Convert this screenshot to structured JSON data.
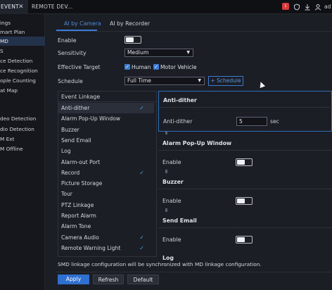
{
  "topbar": {
    "tabs": [
      "EVENT",
      "REMOTE DEV..."
    ],
    "close_glyph": "✕",
    "badge": "1",
    "user": "ad",
    "icons": [
      "notification-icon",
      "shield-icon",
      "download-icon",
      "user-icon"
    ]
  },
  "leftnav": {
    "items": [
      "ings",
      "mart Plan",
      "MD",
      "S",
      "ce Detection",
      "ce Recognition",
      "ople Counting",
      "at Map",
      "deo Detection",
      "dio Detection",
      "M Ext",
      "M Offline"
    ],
    "selected_index": 2
  },
  "subtabs": [
    "AI by Camera",
    "AI by Recorder"
  ],
  "form": {
    "enable_label": "Enable",
    "sensitivity_label": "Sensitivity",
    "sensitivity_value": "Medium",
    "effective_target_label": "Effective Target",
    "target_human": "Human",
    "target_vehicle": "Motor Vehicle",
    "schedule_label": "Schedule",
    "schedule_value": "Full Time",
    "schedule_button": "+ Schedule"
  },
  "linkage": {
    "header": "Event Linkage",
    "items": [
      {
        "label": "Anti-dither",
        "checked": true
      },
      {
        "label": "Alarm Pop-Up Window",
        "checked": false
      },
      {
        "label": "Buzzer",
        "checked": false
      },
      {
        "label": "Send Email",
        "checked": false
      },
      {
        "label": "Log",
        "checked": false
      },
      {
        "label": "Alarm-out Port",
        "checked": false
      },
      {
        "label": "Record",
        "checked": true
      },
      {
        "label": "Picture Storage",
        "checked": false
      },
      {
        "label": "Tour",
        "checked": false
      },
      {
        "label": "PTZ Linkage",
        "checked": false
      },
      {
        "label": "Report Alarm",
        "checked": false
      },
      {
        "label": "Alarm Tone",
        "checked": false
      },
      {
        "label": "Camera Audio",
        "checked": true
      },
      {
        "label": "Remote Warning Light",
        "checked": true
      }
    ],
    "check_glyph": "✓"
  },
  "config": {
    "anti_dither": {
      "title": "Anti-dither",
      "label": "Anti-dither",
      "value": "5",
      "unit": "sec"
    },
    "popup": {
      "title": "Alarm Pop-Up Window",
      "label": "Enable"
    },
    "buzzer": {
      "title": "Buzzer",
      "label": "Enable"
    },
    "email": {
      "title": "Send Email",
      "label": "Enable"
    },
    "log": {
      "title": "Log"
    }
  },
  "note": "SMD linkage configuration will be synchronized with MD linkage configuration.",
  "buttons": {
    "apply": "Apply",
    "refresh": "Refresh",
    "default": "Default"
  },
  "colors": {
    "accent": "#3b7cd4",
    "check": "#4aa3d6",
    "badge": "#d83a3a"
  }
}
